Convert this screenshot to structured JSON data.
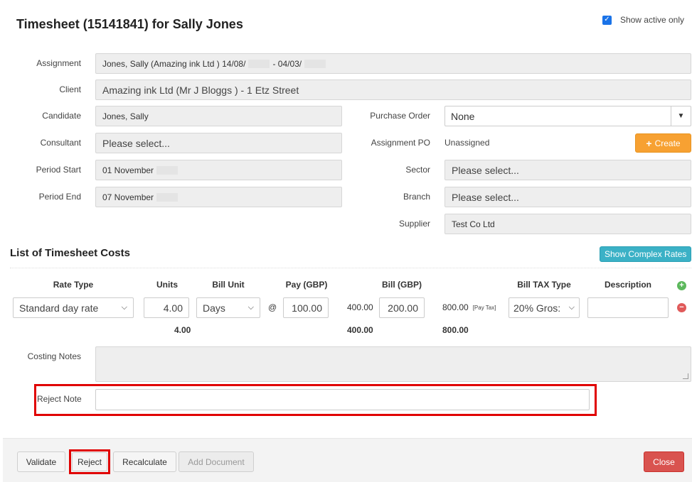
{
  "title": "Timesheet (15141841) for Sally Jones",
  "show_active_only": {
    "label": "Show active only",
    "checked": true
  },
  "labels": {
    "assignment": "Assignment",
    "client": "Client",
    "candidate": "Candidate",
    "consultant": "Consultant",
    "period_start": "Period Start",
    "period_end": "Period End",
    "purchase_order": "Purchase Order",
    "assignment_po": "Assignment PO",
    "sector": "Sector",
    "branch": "Branch",
    "supplier": "Supplier",
    "costing_notes": "Costing Notes",
    "reject_note": "Reject Note"
  },
  "values": {
    "assignment_part1": "Jones, Sally (Amazing ink Ltd ) 14/08/",
    "assignment_part2": "- 04/03/",
    "client": "Amazing ink Ltd  (Mr J Bloggs ) - 1 Etz Street",
    "candidate": "Jones, Sally",
    "consultant_placeholder": "Please select...",
    "period_start": "01 November",
    "period_end": "07 November",
    "purchase_order": "None",
    "assignment_po": "Unassigned",
    "create_label": "Create",
    "sector_placeholder": "Please select...",
    "branch_placeholder": "Please select...",
    "supplier": "Test Co Ltd"
  },
  "costs": {
    "section_title": "List of Timesheet Costs",
    "show_complex_rates": "Show Complex Rates",
    "headers": {
      "rate_type": "Rate Type",
      "units": "Units",
      "bill_unit": "Bill Unit",
      "pay": "Pay (GBP)",
      "bill": "Bill (GBP)",
      "bill_tax_type": "Bill TAX Type",
      "description": "Description"
    },
    "row": {
      "rate_type": "Standard day rate",
      "units": "4.00",
      "bill_unit": "Days",
      "at": "@",
      "pay": "100.00",
      "pay_total": "400.00",
      "bill": "200.00",
      "bill_total": "800.00",
      "pay_tax": "[Pay Tax]",
      "tax_type": "20% Gros:",
      "description": ""
    },
    "totals": {
      "units": "4.00",
      "pay": "400.00",
      "bill": "800.00"
    }
  },
  "footer": {
    "validate": "Validate",
    "reject": "Reject",
    "recalculate": "Recalculate",
    "add_document": "Add Document",
    "close": "Close"
  }
}
